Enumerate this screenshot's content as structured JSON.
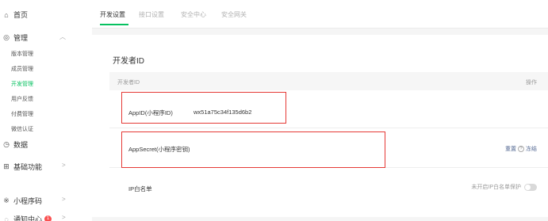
{
  "sidebar": {
    "home": {
      "label": "首页",
      "icon": "home-icon"
    },
    "manage": {
      "label": "管理",
      "icon": "settings-icon",
      "items": [
        {
          "label": "版本管理"
        },
        {
          "label": "成员管理"
        },
        {
          "label": "开发管理"
        },
        {
          "label": "用户反馈"
        },
        {
          "label": "付费管理"
        },
        {
          "label": "微信认证"
        }
      ]
    },
    "data": {
      "label": "数据",
      "icon": "clock-icon"
    },
    "basic": {
      "label": "基础功能",
      "icon": "grid-icon"
    },
    "miniapp": {
      "label": "小程序码",
      "icon": "qr-icon"
    },
    "notice": {
      "label": "通知中心",
      "icon": "bell-icon",
      "badge": "1"
    }
  },
  "tabs": [
    {
      "label": "开发设置"
    },
    {
      "label": "接口设置"
    },
    {
      "label": "安全中心"
    },
    {
      "label": "安全网关"
    }
  ],
  "card": {
    "title": "开发者ID",
    "header": {
      "col1": "开发者ID",
      "col2": "操作"
    },
    "appid": {
      "label": "AppID(小程序ID)",
      "value": "wx51a75c34f135d6b2"
    },
    "secret": {
      "label": "AppSecret(小程序密钥)",
      "reset": "重置",
      "help": "?",
      "freeze": "冻结"
    },
    "ip": {
      "label": "IP白名单",
      "toggle_label": "未开启IP白名单保护"
    }
  },
  "colors": {
    "accent": "#07c160",
    "highlight": "#e53935",
    "link": "#576b95"
  }
}
